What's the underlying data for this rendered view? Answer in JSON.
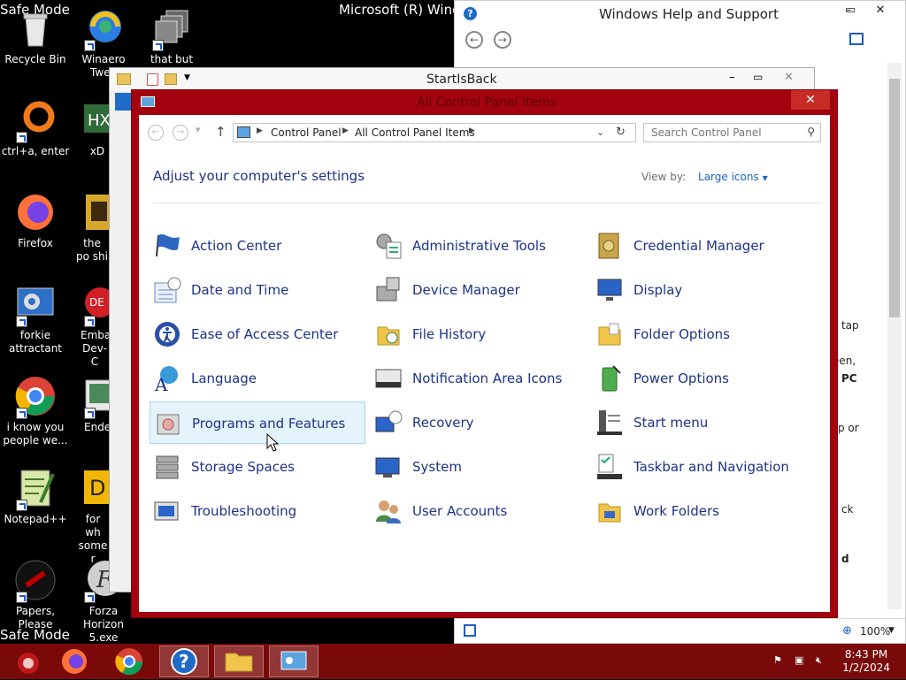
{
  "desktop": {
    "safe_mode_top": "Safe Mode",
    "safe_mode_bottom": "Safe Mode",
    "background_title": "Microsoft (R) Windo",
    "icons": [
      {
        "label": "Recycle Bin"
      },
      {
        "label": "Winaero Twea"
      },
      {
        "label": "that but when"
      },
      {
        "label": "ctrl+a, enter"
      },
      {
        "label": "xD"
      },
      {
        "label": "Firefox"
      },
      {
        "label": "the po shi"
      },
      {
        "label": "forkie attractant"
      },
      {
        "label": "Embarc Dev-C"
      },
      {
        "label": "i know you people we..."
      },
      {
        "label": "Enderm"
      },
      {
        "label": "Notepad++"
      },
      {
        "label": "for wh some r"
      },
      {
        "label": "Papers, Please"
      },
      {
        "label": "Forza Horizon 5.exe"
      }
    ]
  },
  "help_window": {
    "title": "Windows Help and Support",
    "fragments": [
      "tap",
      "een,",
      "PC",
      "p or",
      "ck",
      "d"
    ],
    "zoom": "100%"
  },
  "sib_window": {
    "title": "StartIsBack"
  },
  "control_panel": {
    "title": "All Control Panel Items",
    "breadcrumb": [
      "Control Panel",
      "All Control Panel Items"
    ],
    "search_placeholder": "Search Control Panel",
    "heading": "Adjust your computer's settings",
    "view_by_label": "View by:",
    "view_by_value": "Large icons",
    "items": [
      {
        "label": "Action Center",
        "icon": "flag-icon"
      },
      {
        "label": "Administrative Tools",
        "icon": "admin-tools-icon"
      },
      {
        "label": "Credential Manager",
        "icon": "vault-icon"
      },
      {
        "label": "Date and Time",
        "icon": "calendar-clock-icon"
      },
      {
        "label": "Device Manager",
        "icon": "device-manager-icon"
      },
      {
        "label": "Display",
        "icon": "monitor-icon"
      },
      {
        "label": "Ease of Access Center",
        "icon": "ease-of-access-icon"
      },
      {
        "label": "File History",
        "icon": "file-history-icon"
      },
      {
        "label": "Folder Options",
        "icon": "folder-options-icon"
      },
      {
        "label": "Language",
        "icon": "language-icon"
      },
      {
        "label": "Notification Area Icons",
        "icon": "notification-area-icon"
      },
      {
        "label": "Power Options",
        "icon": "battery-icon"
      },
      {
        "label": "Programs and Features",
        "icon": "programs-icon"
      },
      {
        "label": "Recovery",
        "icon": "recovery-icon"
      },
      {
        "label": "Start menu",
        "icon": "start-menu-icon"
      },
      {
        "label": "Storage Spaces",
        "icon": "storage-icon"
      },
      {
        "label": "System",
        "icon": "system-icon"
      },
      {
        "label": "Taskbar and Navigation",
        "icon": "taskbar-icon"
      },
      {
        "label": "Troubleshooting",
        "icon": "troubleshoot-icon"
      },
      {
        "label": "User Accounts",
        "icon": "users-icon"
      },
      {
        "label": "Work Folders",
        "icon": "work-folders-icon"
      }
    ],
    "hovered_item": "Programs and Features"
  },
  "taskbar": {
    "time": "8:43 PM",
    "date": "1/2/2024",
    "apps": [
      {
        "name": "start-button-icon"
      },
      {
        "name": "firefox-icon"
      },
      {
        "name": "chrome-icon"
      },
      {
        "name": "help-icon"
      },
      {
        "name": "file-explorer-icon"
      },
      {
        "name": "control-panel-icon"
      }
    ]
  },
  "colors": {
    "cp_frame": "#a3030f",
    "taskbar": "#7a0a0a",
    "link_blue": "#1e3287"
  }
}
